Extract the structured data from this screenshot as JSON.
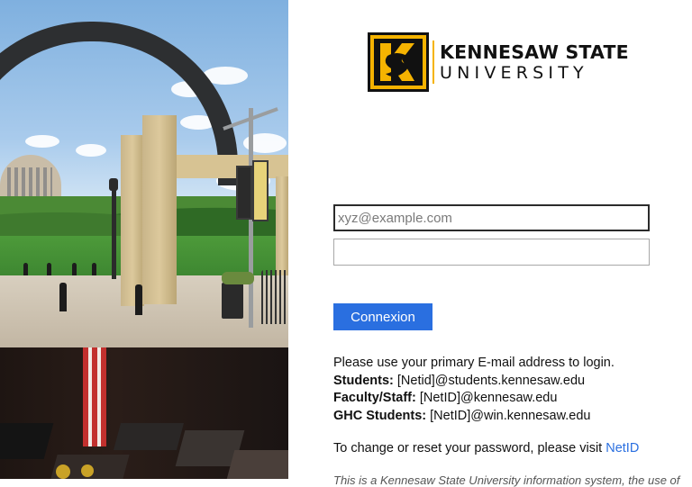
{
  "logo": {
    "line1": "KENNESAW STATE",
    "line2": "UNIVERSITY",
    "colors": {
      "gold": "#f5b301",
      "black": "#111111"
    }
  },
  "form": {
    "email_placeholder": "xyz@example.com",
    "email_value": "",
    "password_value": "",
    "submit_label": "Connexion"
  },
  "info": {
    "intro": "Please use your primary E-mail address to login.",
    "students_label": "Students:",
    "students_value": " [Netid]@students.kennesaw.edu",
    "faculty_label": "Faculty/Staff:",
    "faculty_value": " [NetID]@kennesaw.edu",
    "ghc_label": "GHC Students:",
    "ghc_value": " [NetID]@win.kennesaw.edu",
    "reset_text": "To change or reset your password, please visit ",
    "reset_link": "NetID",
    "cutoff_text": "This is a Kennesaw State University information system, the use of"
  },
  "colors": {
    "accent": "#2a6fe0"
  }
}
